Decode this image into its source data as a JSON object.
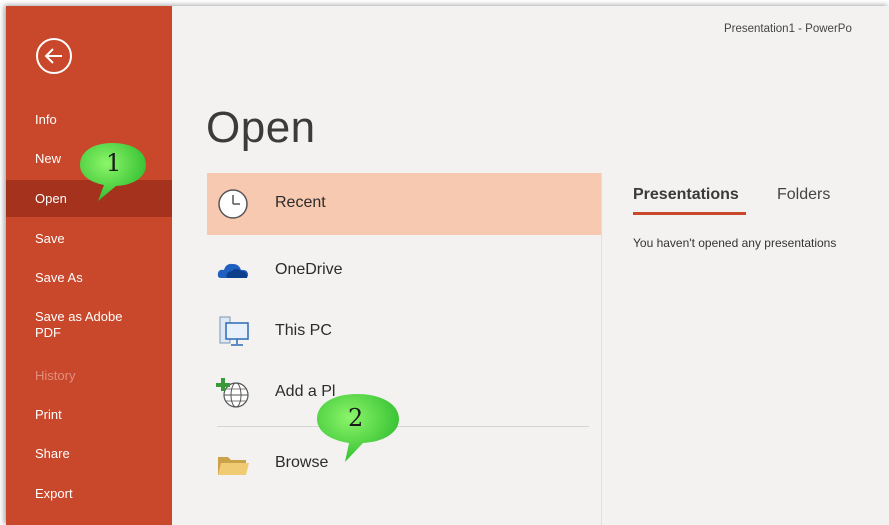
{
  "window": {
    "title": "Presentation1  -  PowerPo"
  },
  "sidebar": {
    "items": [
      {
        "label": "Info"
      },
      {
        "label": "New"
      },
      {
        "label": "Open"
      },
      {
        "label": "Save"
      },
      {
        "label": "Save As"
      },
      {
        "label": "Save as Adobe\nPDF"
      },
      {
        "label": "History"
      },
      {
        "label": "Print"
      },
      {
        "label": "Share"
      },
      {
        "label": "Export"
      }
    ],
    "selected": "Open",
    "colors": {
      "background": "#c9472b",
      "selected": "#a4321c"
    }
  },
  "main": {
    "title": "Open",
    "locations": [
      {
        "label": "Recent",
        "icon": "clock-icon"
      },
      {
        "label": "OneDrive",
        "icon": "cloud-icon"
      },
      {
        "label": "This PC",
        "icon": "computer-icon"
      },
      {
        "label": "Add a Pl",
        "icon": "globe-plus-icon"
      },
      {
        "label": "Browse",
        "icon": "folder-icon"
      }
    ],
    "selected_location": "Recent"
  },
  "right_pane": {
    "tabs": [
      {
        "label": "Presentations"
      },
      {
        "label": "Folders"
      }
    ],
    "active_tab": "Presentations",
    "empty_message": "You haven't opened any presentations"
  },
  "callouts": [
    {
      "number": "1"
    },
    {
      "number": "2"
    }
  ]
}
